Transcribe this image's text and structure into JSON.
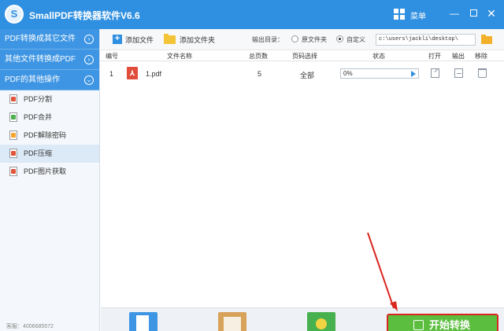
{
  "window": {
    "logo_letter": "S",
    "title": "SmallPDF转换器软件V6.6",
    "menu_label": "菜单",
    "min_symbol": "—",
    "close_symbol": "✕"
  },
  "sidebar": {
    "categories": [
      {
        "label": "PDF转换成其它文件",
        "arrow": "›"
      },
      {
        "label": "其他文件转换成PDF",
        "arrow": "›"
      },
      {
        "label": "PDF的其他操作",
        "arrow": "⌄"
      }
    ],
    "items": [
      {
        "label": "PDF分割",
        "icon_color": "#e0543b"
      },
      {
        "label": "PDF合并",
        "icon_color": "#4caf50"
      },
      {
        "label": "PDF解除密码",
        "icon_color": "#f3a52f"
      },
      {
        "label": "PDF压缩",
        "icon_color": "#e0543b"
      },
      {
        "label": "PDF图片获取",
        "icon_color": "#e0543b"
      }
    ],
    "active_index": 3
  },
  "toolbar": {
    "add_file": "添加文件",
    "add_folder": "添加文件夹",
    "output_label": "输出目录：",
    "option_source": "原文件夹",
    "option_custom": "自定义",
    "output_path": "c:\\users\\jackli\\desktop\\"
  },
  "table": {
    "headers": [
      "编号",
      "文件名称",
      "总页数",
      "页码选择",
      "状态",
      "打开",
      "输出",
      "移除"
    ],
    "rows": [
      {
        "index": "1",
        "filename": "1.pdf",
        "pages": "5",
        "page_select": "全部",
        "status": "0%",
        "progress": 0
      }
    ]
  },
  "footer": {
    "start_label": "开始转换",
    "sidebar_note": "客服：4006685572"
  },
  "colors": {
    "brand_blue": "#2f8fe0",
    "start_green": "#5cbe3f",
    "highlight_red": "#d9271e"
  }
}
